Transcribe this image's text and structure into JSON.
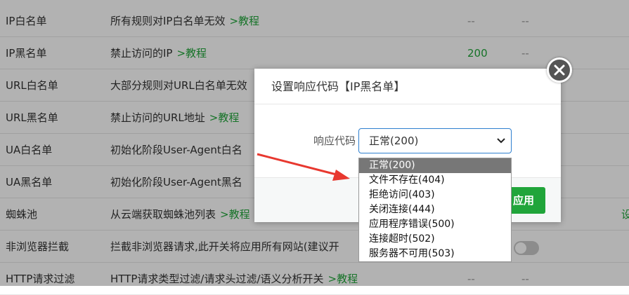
{
  "rows": [
    {
      "name": "IP白名单",
      "desc": "所有规则对IP白名单无效",
      "tutorial": ">教程",
      "code": "--",
      "extra": "--"
    },
    {
      "name": "IP黑名单",
      "desc": "禁止访问的IP",
      "tutorial": ">教程",
      "code": "200",
      "extra": "--"
    },
    {
      "name": "URL白名单",
      "desc": "大部分规则对URL白名单无效",
      "tutorial": "",
      "code": "",
      "extra": ""
    },
    {
      "name": "URL黑名单",
      "desc": "禁止访问的URL地址",
      "tutorial": ">教程",
      "code": "",
      "extra": ""
    },
    {
      "name": "UA白名单",
      "desc": "初始化阶段User-Agent白名",
      "tutorial": "",
      "code": "",
      "extra": ""
    },
    {
      "name": "UA黑名单",
      "desc": "初始化阶段User-Agent黑名",
      "tutorial": "",
      "code": "",
      "extra": ""
    },
    {
      "name": "蜘蛛池",
      "desc": "从云端获取蜘蛛池列表",
      "tutorial": ">教程",
      "code": "",
      "extra": "",
      "right": "设"
    },
    {
      "name": "非浏览器拦截",
      "desc": "拦截非浏览器请求,此开关将应用所有网站(建议开",
      "tutorial": "",
      "code": "",
      "extra": ""
    },
    {
      "name": "HTTP请求过滤",
      "desc": "HTTP请求类型过滤/请求头过滤/语义分析开关",
      "tutorial": ">教程",
      "code": "--",
      "extra": "--"
    }
  ],
  "dialog": {
    "title": "设置响应代码【IP黑名单】",
    "field_label": "响应代码",
    "selected": "正常(200)",
    "apply_label": "应用"
  },
  "options": [
    "正常(200)",
    "文件不存在(404)",
    "拒绝访问(403)",
    "关闭连接(444)",
    "应用程序错误(500)",
    "连接超时(502)",
    "服务器不可用(503)"
  ],
  "colors": {
    "accent": "#20a53a",
    "select_border": "#2e7fcf",
    "arrow": "#e8382f"
  },
  "icons": {
    "close": "close-icon",
    "chevron": "chevron-down-icon",
    "annotation": "red-arrow"
  }
}
